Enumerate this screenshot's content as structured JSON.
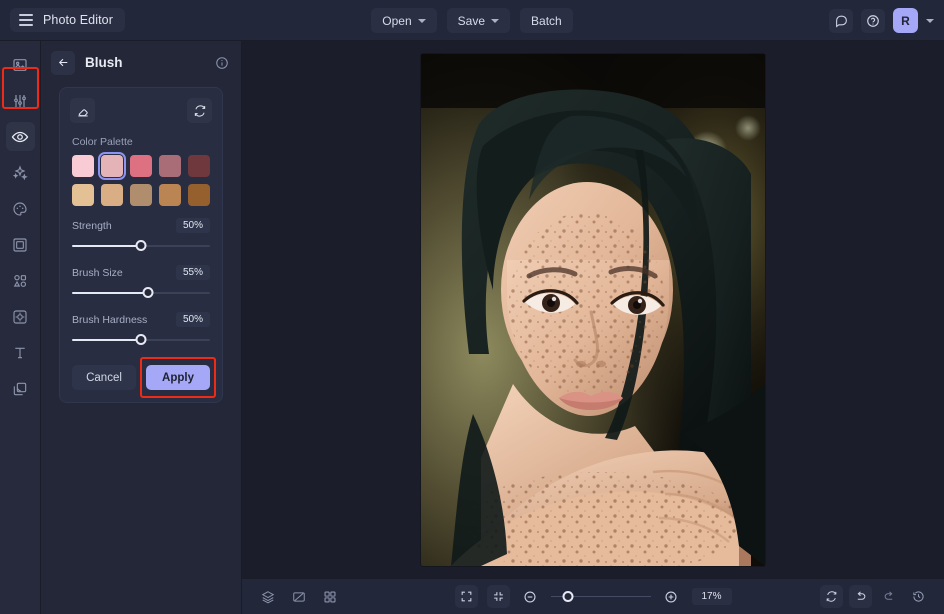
{
  "app": {
    "title": "Photo Editor",
    "menu_icon": "hamburger-icon"
  },
  "topbar": {
    "open_label": "Open",
    "save_label": "Save",
    "batch_label": "Batch",
    "feedback_icon": "comment-icon",
    "help_icon": "question-circle-icon",
    "avatar_initial": "R"
  },
  "sidebar": {
    "items": [
      {
        "name": "image",
        "icon": "image-icon"
      },
      {
        "name": "adjust",
        "icon": "sliders-icon"
      },
      {
        "name": "retouch",
        "icon": "eye-icon",
        "active": true,
        "highlighted": true
      },
      {
        "name": "effects",
        "icon": "sparkles-icon"
      },
      {
        "name": "color",
        "icon": "palette-icon"
      },
      {
        "name": "frame",
        "icon": "frame-icon"
      },
      {
        "name": "shapes",
        "icon": "shapes-icon"
      },
      {
        "name": "blur",
        "icon": "focus-icon"
      },
      {
        "name": "text",
        "icon": "text-icon"
      },
      {
        "name": "layers",
        "icon": "copy-layers-icon"
      }
    ]
  },
  "panel": {
    "title": "Blush",
    "back_icon": "arrow-left-icon",
    "info_icon": "info-circle-icon",
    "eraser_icon": "eraser-icon",
    "reset_icon": "refresh-icon",
    "palette_label": "Color Palette",
    "swatches_row1": [
      "#f9cbd4",
      "#e4b3b8",
      "#dd7182",
      "#a96d78",
      "#6e383c"
    ],
    "swatches_row2": [
      "#e3c194",
      "#d9ae85",
      "#b08e6d",
      "#bb8453",
      "#96602e"
    ],
    "selected_swatch_index": 1,
    "sliders": [
      {
        "label": "Strength",
        "value": "50%",
        "percent": 50
      },
      {
        "label": "Brush Size",
        "value": "55%",
        "percent": 55
      },
      {
        "label": "Brush Hardness",
        "value": "50%",
        "percent": 50
      }
    ],
    "cancel_label": "Cancel",
    "apply_label": "Apply",
    "apply_highlighted": true
  },
  "bottombar": {
    "layers_icon": "layers-icon",
    "compare_icon": "compare-icon",
    "grid_icon": "grid-icon",
    "fit_icon": "fit-screen-icon",
    "actual_icon": "collapse-icon",
    "zoom_out_icon": "minus-circle-icon",
    "zoom_in_icon": "plus-circle-icon",
    "zoom_value": "17%",
    "zoom_percent": 17,
    "reset_view_icon": "refresh-icon",
    "undo_icon": "undo-icon",
    "redo_icon": "redo-icon",
    "history_icon": "history-icon"
  },
  "colors": {
    "accent": "#a5a8f6",
    "highlight": "#ee2b17",
    "panel_bg": "#232738",
    "canvas_bg": "#1b1e2a",
    "topbar_bg": "#23273a"
  },
  "canvas": {
    "image_alt": "portrait-photo-woman-freckles"
  }
}
